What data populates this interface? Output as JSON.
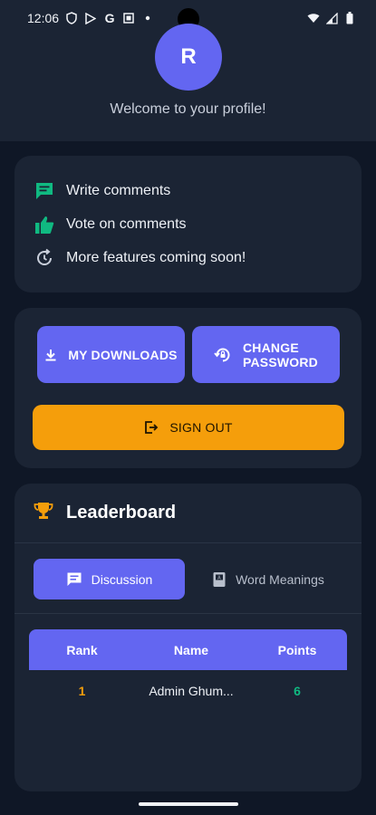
{
  "status_bar": {
    "time": "12:06",
    "icons": [
      "shield-icon",
      "play-store-icon",
      "google-icon",
      "screen-icon",
      "dot-icon"
    ],
    "right_icons": [
      "wifi-icon",
      "signal-icon",
      "battery-icon"
    ]
  },
  "profile": {
    "avatar_letter": "R",
    "welcome": "Welcome to your profile!"
  },
  "features": [
    {
      "icon": "comment-icon",
      "label": "Write comments",
      "color": "#10b981"
    },
    {
      "icon": "thumbs-up-icon",
      "label": "Vote on comments",
      "color": "#10b981"
    },
    {
      "icon": "refresh-icon",
      "label": "More features coming soon!",
      "color": "#c9cfdb"
    }
  ],
  "actions": {
    "downloads_label": "MY DOWNLOADS",
    "change_password_line1": "CHANGE",
    "change_password_line2": "PASSWORD",
    "sign_out_label": "SIGN OUT"
  },
  "leaderboard": {
    "title": "Leaderboard",
    "tabs": [
      {
        "label": "Discussion",
        "active": true
      },
      {
        "label": "Word Meanings",
        "active": false
      }
    ],
    "columns": [
      "Rank",
      "Name",
      "Points"
    ],
    "rows": [
      {
        "rank": "1",
        "name": "Admin Ghum...",
        "points": "6"
      }
    ]
  },
  "colors": {
    "accent": "#6366f1",
    "warning": "#f59e0b",
    "success": "#10b981",
    "background": "#0f1726",
    "card": "#1b2434"
  }
}
